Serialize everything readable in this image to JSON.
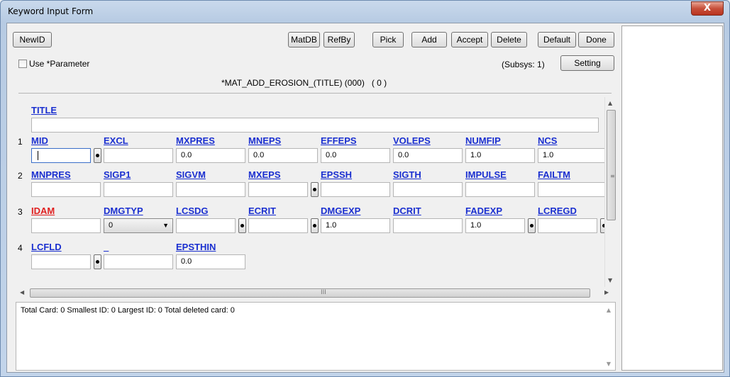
{
  "window": {
    "title": "Keyword Input Form",
    "close_label": "X"
  },
  "toolbar": {
    "newid": "NewID",
    "matdb": "MatDB",
    "refby": "RefBy",
    "pick": "Pick",
    "add": "Add",
    "accept": "Accept",
    "delete": "Delete",
    "default": "Default",
    "done": "Done",
    "setting": "Setting"
  },
  "options": {
    "use_parameter": "Use *Parameter",
    "subsys": "(Subsys: 1)"
  },
  "keyword": {
    "title": "*MAT_ADD_EROSION_(TITLE) (000)   ( 0 )"
  },
  "form": {
    "title_label": "TITLE",
    "title_value": "",
    "rows": [
      {
        "num": "1",
        "labels": [
          "MID",
          "EXCL",
          "MXPRES",
          "MNEPS",
          "EFFEPS",
          "VOLEPS",
          "NUMFIP",
          "NCS"
        ],
        "values": [
          "",
          "",
          "0.0",
          "0.0",
          "0.0",
          "0.0",
          "1.0",
          "1.0"
        ]
      },
      {
        "num": "2",
        "labels": [
          "MNPRES",
          "SIGP1",
          "SIGVM",
          "MXEPS",
          "EPSSH",
          "SIGTH",
          "IMPULSE",
          "FAILTM"
        ],
        "values": [
          "",
          "",
          "",
          "",
          "",
          "",
          "",
          ""
        ]
      },
      {
        "num": "3",
        "labels": [
          "IDAM",
          "DMGTYP",
          "LCSDG",
          "ECRIT",
          "DMGEXP",
          "DCRIT",
          "FADEXP",
          "LCREGD"
        ],
        "values": [
          "",
          "0",
          "",
          "",
          "1.0",
          "",
          "1.0",
          ""
        ]
      },
      {
        "num": "4",
        "labels": [
          "LCFLD",
          "_",
          "EPSTHIN"
        ],
        "values": [
          "",
          "",
          "0.0"
        ]
      }
    ]
  },
  "status": {
    "text": "Total Card: 0    Smallest ID: 0   Largest ID: 0   Total deleted card:  0"
  },
  "scroll": {
    "grip": "III",
    "grip_v": "≡"
  }
}
